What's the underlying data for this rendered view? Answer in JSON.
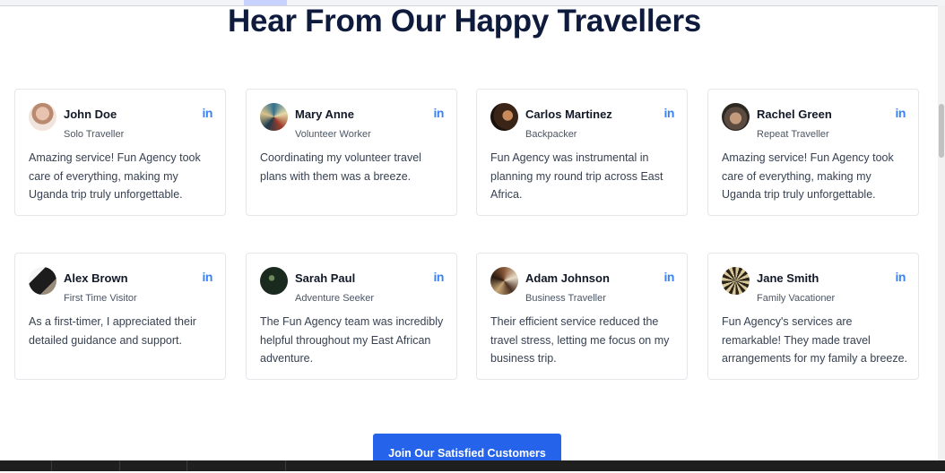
{
  "heading": "Hear From Our Happy Travellers",
  "testimonials": [
    {
      "name": "John Doe",
      "role": "Solo Traveller",
      "quote": "Amazing service! Fun Agency took care of everything, making my Uganda trip truly unforgettable.",
      "social": "in"
    },
    {
      "name": "Mary Anne",
      "role": "Volunteer Worker",
      "quote": "Coordinating my volunteer travel plans with them was a breeze.",
      "social": "in"
    },
    {
      "name": "Carlos Martinez",
      "role": "Backpacker",
      "quote": "Fun Agency was instrumental in planning my round trip across East Africa.",
      "social": "in"
    },
    {
      "name": "Rachel Green",
      "role": "Repeat Traveller",
      "quote": "Amazing service! Fun Agency took care of everything, making my Uganda trip truly unforgettable.",
      "social": "in"
    },
    {
      "name": "Alex Brown",
      "role": "First Time Visitor",
      "quote": "As a first-timer, I appreciated their detailed guidance and support.",
      "social": "in"
    },
    {
      "name": "Sarah Paul",
      "role": "Adventure Seeker",
      "quote": "The Fun Agency team was incredibly helpful throughout my East African adventure.",
      "social": "in"
    },
    {
      "name": "Adam Johnson",
      "role": "Business Traveller",
      "quote": "Their efficient service reduced the travel stress, letting me focus on my business trip.",
      "social": "in"
    },
    {
      "name": "Jane Smith",
      "role": "Family Vacationer",
      "quote": "Fun Agency's services are remarkable! They made travel arrangements for my family a breeze.",
      "social": "in"
    }
  ],
  "cta_label": "Join Our Satisfied Customers",
  "colors": {
    "accent": "#2563eb",
    "heading": "#0f1b3d",
    "linkedin": "#3b82f6"
  }
}
